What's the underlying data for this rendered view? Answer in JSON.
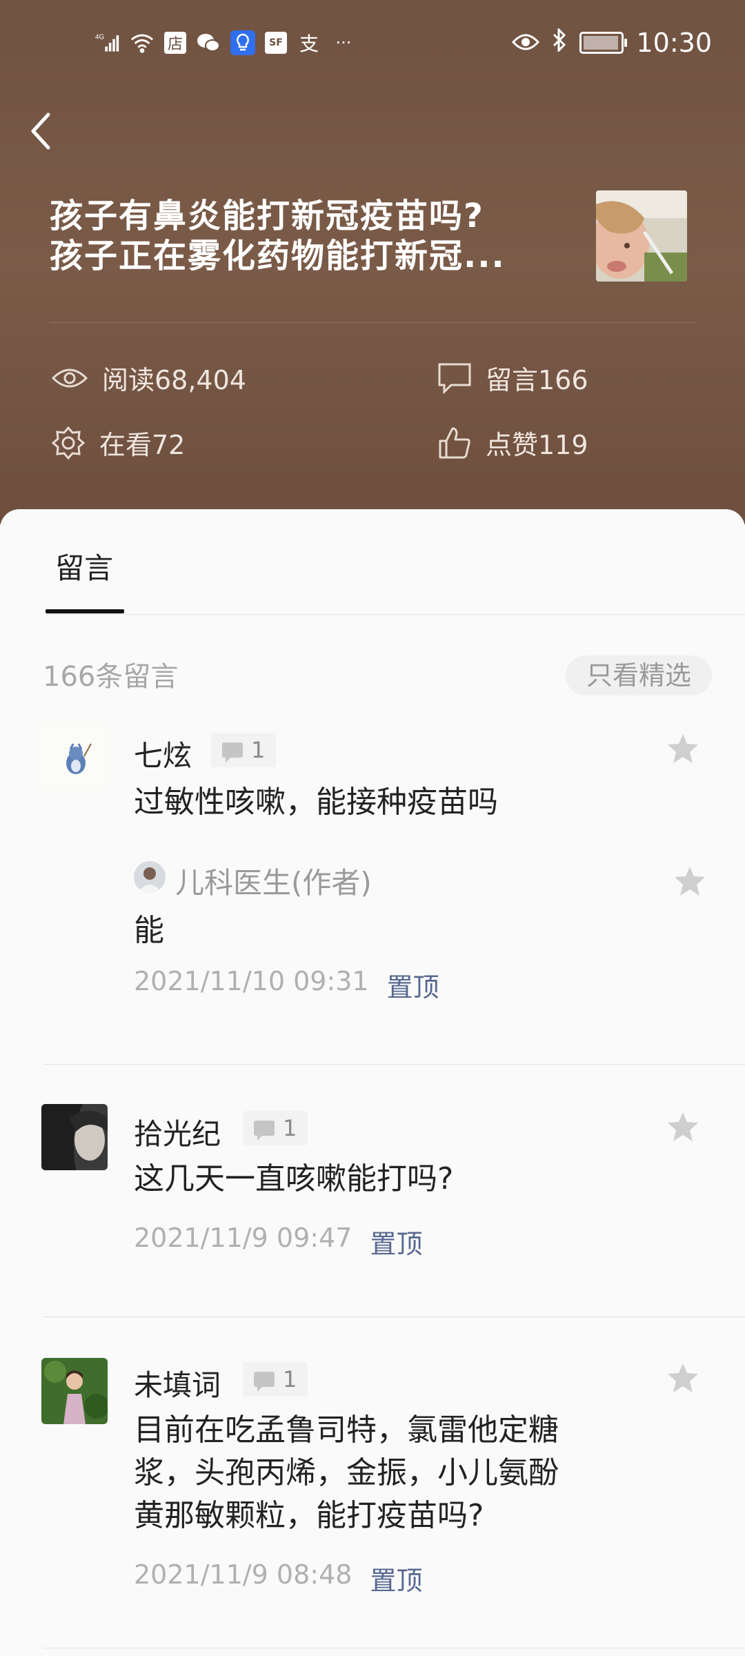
{
  "status_bar": {
    "network": "4G",
    "left_icons": [
      "signal-icon",
      "wifi-icon",
      "store-icon",
      "wechat-icon",
      "bulb-icon",
      "sf-icon",
      "alipay-icon",
      "more-dots-icon"
    ],
    "store_glyph": "店",
    "sf_glyph": "SF",
    "alipay_glyph": "支",
    "more_glyph": "···",
    "time": "10:30"
  },
  "article": {
    "title_line1": "孩子有鼻炎能打新冠疫苗吗?",
    "title_line2": "孩子正在雾化药物能打新冠..."
  },
  "stats": {
    "reads": "阅读68,404",
    "comments": "留言166",
    "watching": "在看72",
    "likes": "点赞119"
  },
  "tabs": {
    "active": "留言"
  },
  "comments_header": {
    "count": "166条留言",
    "filter": "只看精选"
  },
  "comments": [
    {
      "name": "七炫",
      "replies": "1",
      "text": "过敏性咳嗽，能接种疫苗吗",
      "reply": {
        "author": "儿科医生(作者)",
        "text": "能",
        "time": "2021/11/10 09:31",
        "pin": "置顶"
      }
    },
    {
      "name": "拾光纪",
      "replies": "1",
      "text": "这几天一直咳嗽能打吗?",
      "time": "2021/11/9 09:47",
      "pin": "置顶"
    },
    {
      "name": "未填词",
      "replies": "1",
      "text_line1": "目前在吃孟鲁司特，氯雷他定糖",
      "text_line2": "浆，头孢丙烯，金振，小儿氨酚",
      "text_line3": "黄那敏颗粒，能打疫苗吗?",
      "time": "2021/11/9 08:48",
      "pin": "置顶"
    }
  ]
}
